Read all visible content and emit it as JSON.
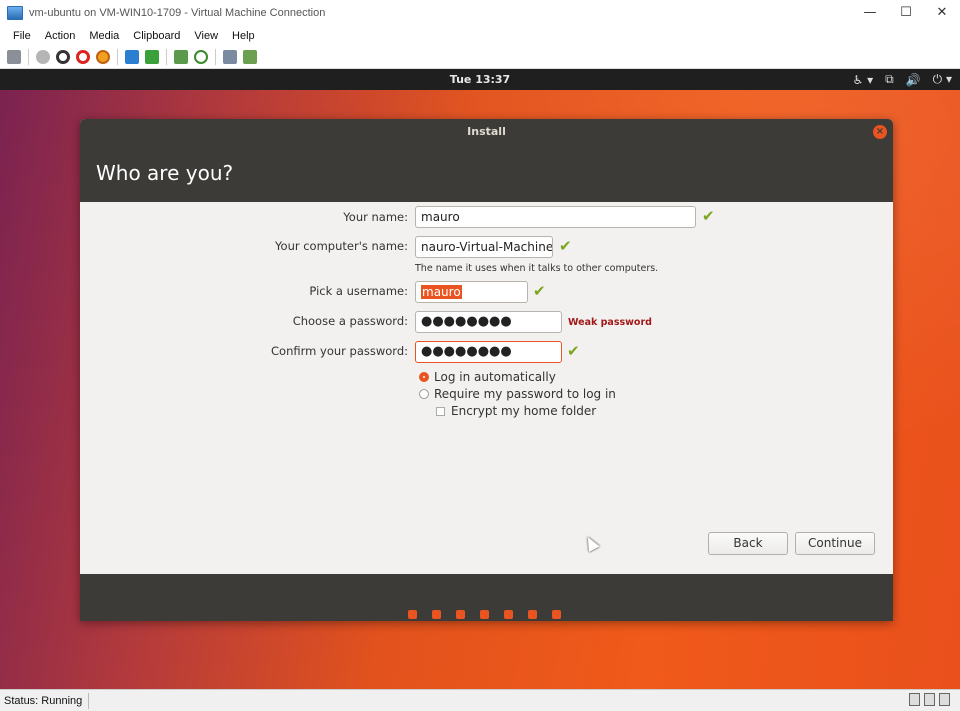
{
  "window": {
    "title": "vm-ubuntu on VM-WIN10-1709 - Virtual Machine Connection",
    "minimize": "—",
    "maximize": "☐",
    "close": "✕"
  },
  "menu": [
    "File",
    "Action",
    "Media",
    "Clipboard",
    "View",
    "Help"
  ],
  "ubuntu": {
    "clock": "Tue 13:37"
  },
  "installer": {
    "window_title": "Install",
    "heading": "Who are you?",
    "fields": {
      "name_label": "Your name:",
      "name_value": "mauro",
      "computer_label": "Your computer's name:",
      "computer_value": "nauro-Virtual-Machine",
      "computer_hint": "The name it uses when it talks to other computers.",
      "username_label": "Pick a username:",
      "username_value": "mauro",
      "password_label": "Choose a password:",
      "password_value": "●●●●●●●●",
      "password_strength": "Weak password",
      "confirm_label": "Confirm your password:",
      "confirm_value": "●●●●●●●●"
    },
    "options": {
      "auto_login": "Log in automatically",
      "require_password": "Require my password to log in",
      "encrypt_home": "Encrypt my home folder"
    },
    "buttons": {
      "back": "Back",
      "continue": "Continue"
    },
    "progress_steps": 7
  },
  "status": {
    "text": "Status: Running"
  },
  "colors": {
    "ubuntu_orange": "#e95420",
    "dark_panel": "#3c3b37",
    "check_green": "#7aa61e",
    "weak_red": "#a01818"
  }
}
